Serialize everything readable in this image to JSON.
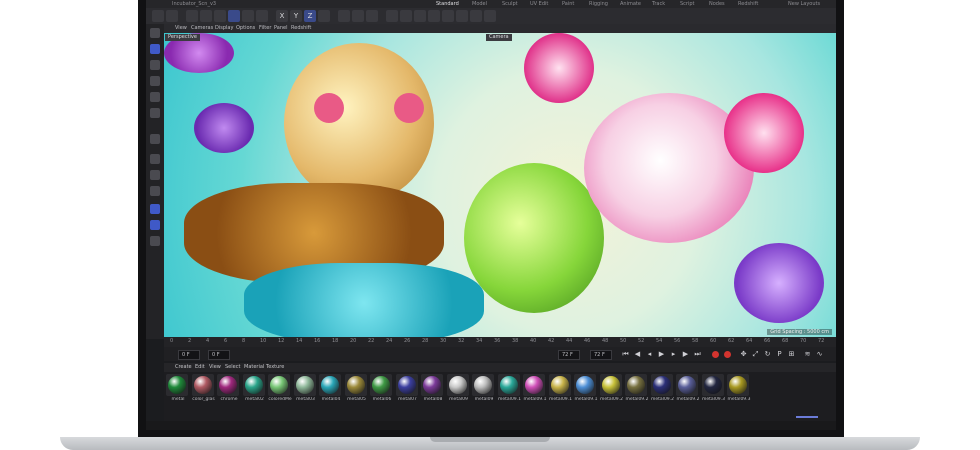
{
  "topbar": {
    "file": "Incubator_Scn_v3",
    "tab_active": "Standard",
    "tab2": "Model",
    "tab3": "Sculpt",
    "tab4": "UV Edit",
    "tab5": "Paint",
    "tab6": "Rigging",
    "tab7": "Animate",
    "tab8": "Track",
    "tab9": "Script",
    "tab10": "Nodes",
    "tab11": "Redshift",
    "layout": "New Layouts"
  },
  "toolbar": {
    "x": "X",
    "y": "Y",
    "z": "Z"
  },
  "viewport_menu": {
    "view": "View",
    "cameras": "Cameras",
    "display": "Display",
    "options": "Options",
    "filter": "Filter",
    "panel": "Panel",
    "redshift": "Redshift"
  },
  "viewport": {
    "name": "Perspective",
    "camera": "Camera",
    "grid_spacing": "Grid Spacing : 5000 cm"
  },
  "ruler": {
    "ticks": [
      "0",
      "2",
      "4",
      "6",
      "8",
      "10",
      "12",
      "14",
      "16",
      "18",
      "20",
      "22",
      "24",
      "26",
      "28",
      "30",
      "32",
      "34",
      "36",
      "38",
      "40",
      "42",
      "44",
      "46",
      "48",
      "50",
      "52",
      "54",
      "56",
      "58",
      "60",
      "62",
      "64",
      "66",
      "68",
      "70",
      "72"
    ]
  },
  "playbar": {
    "start": "0 F",
    "current": "0 F",
    "end_a": "72 F",
    "end_b": "72 F"
  },
  "material_menu": {
    "create": "Create",
    "edit": "Edit",
    "view": "View",
    "select": "Select",
    "material": "Material",
    "texture": "Texture"
  },
  "materials": [
    {
      "name": "metal",
      "color": "#1f8a3a"
    },
    {
      "name": "color_glas",
      "color": "#b05a63"
    },
    {
      "name": "chrome",
      "color": "#a0287e"
    },
    {
      "name": "metal02",
      "color": "#2aa58a"
    },
    {
      "name": "coloredMe",
      "color": "#78c776"
    },
    {
      "name": "metal03",
      "color": "#8fb89a"
    },
    {
      "name": "metal04",
      "color": "#2aa7b8"
    },
    {
      "name": "metal05",
      "color": "#9c8a3a"
    },
    {
      "name": "metal06",
      "color": "#3f9a45"
    },
    {
      "name": "metal07",
      "color": "#3c3fa0"
    },
    {
      "name": "metal08",
      "color": "#7c3a9a"
    },
    {
      "name": "metal09",
      "color": "#c9c9c9"
    },
    {
      "name": "metal09",
      "color": "#bdbdbd"
    },
    {
      "name": "metal09.1",
      "color": "#2aa99a"
    },
    {
      "name": "metal09.1",
      "color": "#d04fb8"
    },
    {
      "name": "metal09.1",
      "color": "#c9b44a"
    },
    {
      "name": "metal09.1",
      "color": "#4d8fd6"
    },
    {
      "name": "metal09.2",
      "color": "#c8c23a"
    },
    {
      "name": "metal09.2",
      "color": "#777040"
    },
    {
      "name": "metal09.2",
      "color": "#2b2f78"
    },
    {
      "name": "metal09.2",
      "color": "#5a5f9a"
    },
    {
      "name": "metal09.3",
      "color": "#222640"
    },
    {
      "name": "metal09.3",
      "color": "#a99a22"
    }
  ]
}
